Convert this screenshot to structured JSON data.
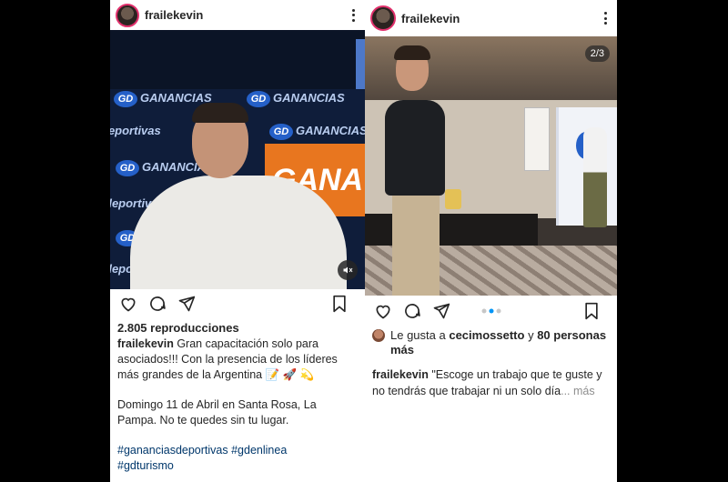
{
  "left_post": {
    "username": "frailekevin",
    "brand_text": "GANANCIAS",
    "brand_sub": "deportivas",
    "brand_band": "GANA",
    "logo_letters": "GD",
    "views": "2.805 reproducciones",
    "caption_user": "frailekevin",
    "caption_line1": "Gran capacitación solo para asociados!!! Con la presencia de los líderes más grandes de la Argentina 📝 🚀 💫",
    "caption_line2": "Domingo 11 de Abril en Santa Rosa, La Pampa. No te quedes sin tu lugar.",
    "hashtag1": "#gananciasdeportivas",
    "hashtag2": "#gdenlinea",
    "hashtag3": "#gdturismo"
  },
  "right_post": {
    "username": "frailekevin",
    "slide_counter": "2/3",
    "liked_prefix": "Le gusta a",
    "liked_user": "cecimossetto",
    "liked_middle": "y",
    "liked_others": "80 personas más",
    "caption_user": "frailekevin",
    "caption_text": "\"Escoge un trabajo que te guste y no tendrás que trabajar ni un solo día",
    "more_label": "... más"
  },
  "colors": {
    "accent_blue": "#0095f6",
    "hashtag": "#00376b",
    "brand_blue": "#2560c8",
    "brand_orange": "#e8761f"
  },
  "icons": [
    "heart-icon",
    "comment-icon",
    "share-icon",
    "bookmark-icon",
    "more-options-icon",
    "mute-icon"
  ]
}
